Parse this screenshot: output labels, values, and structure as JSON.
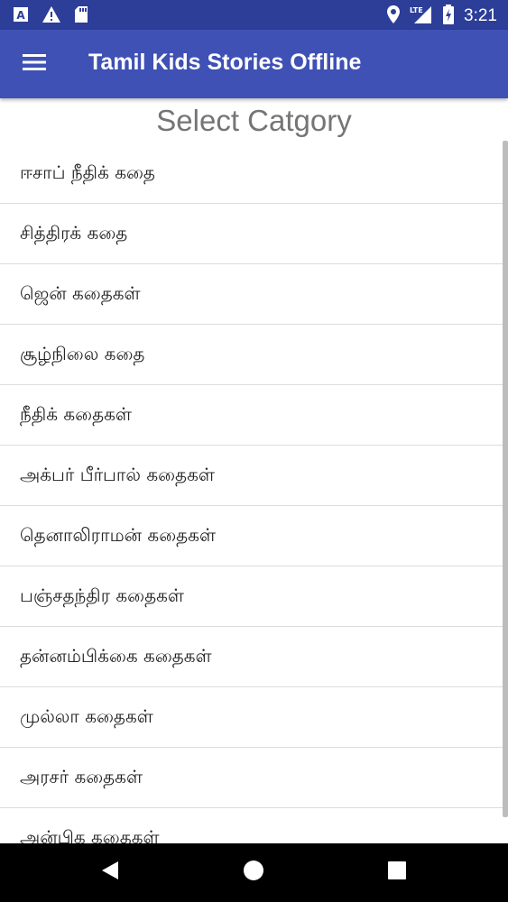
{
  "status_bar": {
    "time": "3:21",
    "network": "LTE",
    "left_icons": [
      "font-a-icon",
      "warning-icon",
      "sd-card-icon"
    ],
    "right_icons": [
      "location-icon",
      "signal-icon",
      "battery-charging-icon"
    ]
  },
  "app_bar": {
    "title": "Tamil Kids Stories Offline",
    "menu_icon": "hamburger-menu-icon",
    "background": "#3f51b5"
  },
  "heading": "Select Catgory",
  "categories": [
    "ஈசாப் நீதிக் கதை",
    "சித்திரக் கதை",
    "ஜென் கதைகள்",
    "சூழ்நிலை கதை",
    "நீதிக் கதைகள்",
    "அக்பர் பீர்பால் கதைகள்",
    "தெனாலிராமன் கதைகள்",
    "பஞ்சதந்திர கதைகள்",
    "தன்னம்பிக்கை கதைகள்",
    "முல்லா கதைகள்",
    "அரசர் கதைகள்",
    "அன்பிக கதைகள்"
  ],
  "nav_bar": {
    "back_icon": "back-triangle-icon",
    "home_icon": "home-circle-icon",
    "recents_icon": "recents-square-icon"
  }
}
